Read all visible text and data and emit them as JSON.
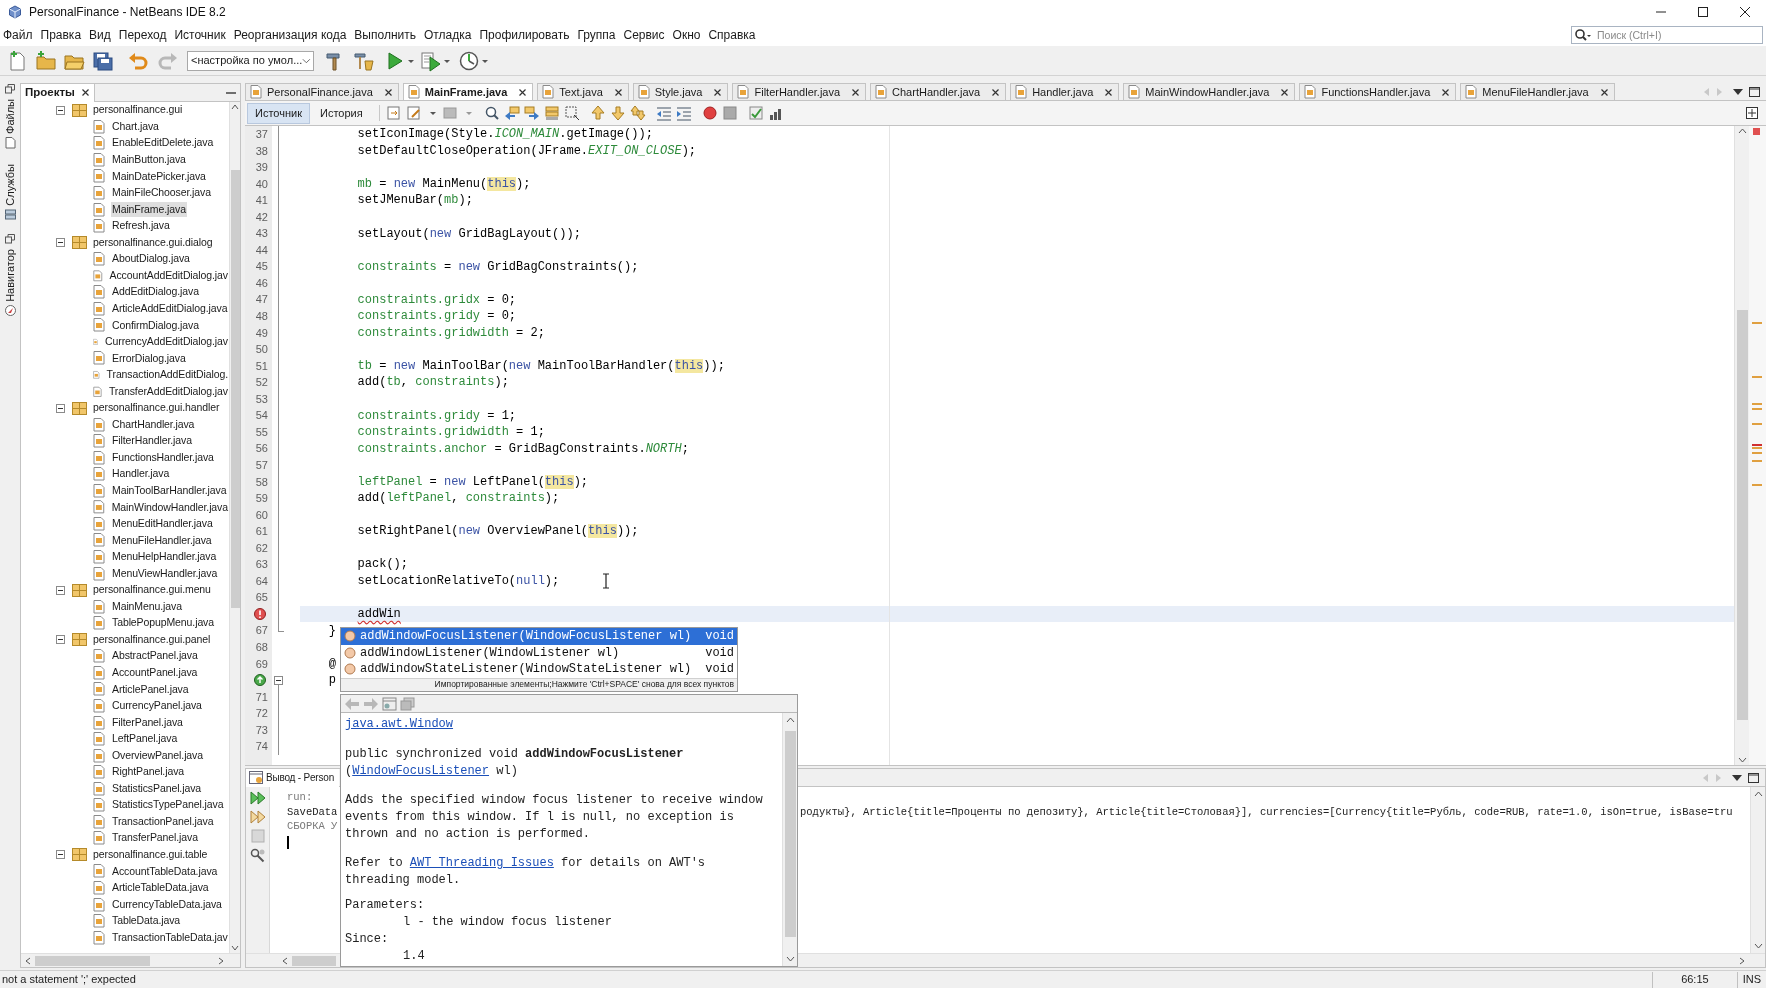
{
  "window": {
    "title": "PersonalFinance - NetBeans IDE 8.2"
  },
  "menu": [
    "Файл",
    "Правка",
    "Вид",
    "Переход",
    "Источник",
    "Реорганизация кода",
    "Выполнить",
    "Отладка",
    "Профилировать",
    "Группа",
    "Сервис",
    "Окно",
    "Справка"
  ],
  "search": {
    "placeholder": "Поиск (Ctrl+I)"
  },
  "toolbar": {
    "configuration": "<настройка по умол..."
  },
  "side_tabs": [
    "Файлы",
    "Службы",
    "Навигатор"
  ],
  "projects": {
    "title": "Проекты",
    "tree": [
      {
        "label": "personalfinance.gui",
        "kind": "package",
        "expanded": true,
        "selected": false,
        "children": [
          {
            "label": "Chart.java",
            "kind": "file",
            "selected": false
          },
          {
            "label": "EnableEditDelete.java",
            "kind": "file",
            "selected": false
          },
          {
            "label": "MainButton.java",
            "kind": "file",
            "selected": false
          },
          {
            "label": "MainDatePicker.java",
            "kind": "file",
            "selected": false
          },
          {
            "label": "MainFileChooser.java",
            "kind": "file",
            "selected": false
          },
          {
            "label": "MainFrame.java",
            "kind": "file",
            "selected": true
          },
          {
            "label": "Refresh.java",
            "kind": "file",
            "selected": false
          }
        ]
      },
      {
        "label": "personalfinance.gui.dialog",
        "kind": "package",
        "expanded": true,
        "selected": false,
        "children": [
          {
            "label": "AboutDialog.java",
            "kind": "file",
            "selected": false
          },
          {
            "label": "AccountAddEditDialog.jav",
            "kind": "file",
            "selected": false
          },
          {
            "label": "AddEditDialog.java",
            "kind": "file",
            "selected": false
          },
          {
            "label": "ArticleAddEditDialog.java",
            "kind": "file",
            "selected": false
          },
          {
            "label": "ConfirmDialog.java",
            "kind": "file",
            "selected": false
          },
          {
            "label": "CurrencyAddEditDialog.jav",
            "kind": "file",
            "selected": false
          },
          {
            "label": "ErrorDialog.java",
            "kind": "file",
            "selected": false
          },
          {
            "label": "TransactionAddEditDialog.",
            "kind": "file",
            "selected": false
          },
          {
            "label": "TransferAddEditDialog.jav",
            "kind": "file",
            "selected": false
          }
        ]
      },
      {
        "label": "personalfinance.gui.handler",
        "kind": "package",
        "expanded": true,
        "selected": false,
        "children": [
          {
            "label": "ChartHandler.java",
            "kind": "file",
            "selected": false
          },
          {
            "label": "FilterHandler.java",
            "kind": "file",
            "selected": false
          },
          {
            "label": "FunctionsHandler.java",
            "kind": "file",
            "selected": false
          },
          {
            "label": "Handler.java",
            "kind": "file",
            "selected": false
          },
          {
            "label": "MainToolBarHandler.java",
            "kind": "file",
            "selected": false
          },
          {
            "label": "MainWindowHandler.java",
            "kind": "file",
            "selected": false
          },
          {
            "label": "MenuEditHandler.java",
            "kind": "file",
            "selected": false
          },
          {
            "label": "MenuFileHandler.java",
            "kind": "file",
            "selected": false
          },
          {
            "label": "MenuHelpHandler.java",
            "kind": "file",
            "selected": false
          },
          {
            "label": "MenuViewHandler.java",
            "kind": "file",
            "selected": false
          }
        ]
      },
      {
        "label": "personalfinance.gui.menu",
        "kind": "package",
        "expanded": true,
        "selected": false,
        "children": [
          {
            "label": "MainMenu.java",
            "kind": "file",
            "selected": false
          },
          {
            "label": "TablePopupMenu.java",
            "kind": "file",
            "selected": false
          }
        ]
      },
      {
        "label": "personalfinance.gui.panel",
        "kind": "package",
        "expanded": true,
        "selected": false,
        "children": [
          {
            "label": "AbstractPanel.java",
            "kind": "file",
            "selected": false
          },
          {
            "label": "AccountPanel.java",
            "kind": "file",
            "selected": false
          },
          {
            "label": "ArticlePanel.java",
            "kind": "file",
            "selected": false
          },
          {
            "label": "CurrencyPanel.java",
            "kind": "file",
            "selected": false
          },
          {
            "label": "FilterPanel.java",
            "kind": "file",
            "selected": false
          },
          {
            "label": "LeftPanel.java",
            "kind": "file",
            "selected": false
          },
          {
            "label": "OverviewPanel.java",
            "kind": "file",
            "selected": false
          },
          {
            "label": "RightPanel.java",
            "kind": "file",
            "selected": false
          },
          {
            "label": "StatisticsPanel.java",
            "kind": "file",
            "selected": false
          },
          {
            "label": "StatisticsTypePanel.java",
            "kind": "file",
            "selected": false
          },
          {
            "label": "TransactionPanel.java",
            "kind": "file",
            "selected": false
          },
          {
            "label": "TransferPanel.java",
            "kind": "file",
            "selected": false
          }
        ]
      },
      {
        "label": "personalfinance.gui.table",
        "kind": "package",
        "expanded": true,
        "selected": false,
        "children": [
          {
            "label": "AccountTableData.java",
            "kind": "file",
            "selected": false
          },
          {
            "label": "ArticleTableData.java",
            "kind": "file",
            "selected": false
          },
          {
            "label": "CurrencyTableData.java",
            "kind": "file",
            "selected": false
          },
          {
            "label": "TableData.java",
            "kind": "file",
            "selected": false
          },
          {
            "label": "TransactionTableData.jav",
            "kind": "file",
            "selected": false
          }
        ]
      }
    ]
  },
  "editor": {
    "tabs": [
      {
        "label": "PersonalFinance.java",
        "selected": false
      },
      {
        "label": "MainFrame.java",
        "selected": true
      },
      {
        "label": "Text.java",
        "selected": false
      },
      {
        "label": "Style.java",
        "selected": false
      },
      {
        "label": "FilterHandler.java",
        "selected": false
      },
      {
        "label": "ChartHandler.java",
        "selected": false
      },
      {
        "label": "Handler.java",
        "selected": false
      },
      {
        "label": "MainWindowHandler.java",
        "selected": false
      },
      {
        "label": "FunctionsHandler.java",
        "selected": false
      },
      {
        "label": "MenuFileHandler.java",
        "selected": false
      }
    ],
    "views": [
      {
        "label": "Источник",
        "selected": true
      },
      {
        "label": "История",
        "selected": false
      }
    ],
    "lines": [
      {
        "number": "37",
        "kind": "guide",
        "current": false,
        "tokens": [
          {
            "kind": "text",
            "text": "        setIconImage(Style."
          },
          {
            "kind": "constant",
            "text": "ICON_MAIN"
          },
          {
            "kind": "text",
            "text": ".getImage());"
          }
        ]
      },
      {
        "number": "38",
        "kind": "guide",
        "current": false,
        "tokens": [
          {
            "kind": "text",
            "text": "        setDefaultCloseOperation(JFrame."
          },
          {
            "kind": "constant",
            "text": "EXIT_ON_CLOSE"
          },
          {
            "kind": "text",
            "text": ");"
          }
        ]
      },
      {
        "number": "39",
        "kind": "guide",
        "current": false
      },
      {
        "number": "40",
        "kind": "guide",
        "current": false,
        "tokens": [
          {
            "kind": "field",
            "text": "        mb"
          },
          {
            "kind": "text",
            "text": " = "
          },
          {
            "kind": "keyword",
            "text": "new"
          },
          {
            "kind": "text",
            "text": " MainMenu("
          },
          {
            "kind": "this",
            "text": "this"
          },
          {
            "kind": "text",
            "text": ");"
          }
        ]
      },
      {
        "number": "41",
        "kind": "guide",
        "current": false,
        "tokens": [
          {
            "kind": "text",
            "text": "        setJMenuBar("
          },
          {
            "kind": "field",
            "text": "mb"
          },
          {
            "kind": "text",
            "text": ");"
          }
        ]
      },
      {
        "number": "42",
        "kind": "guide",
        "current": false
      },
      {
        "number": "43",
        "kind": "guide",
        "current": false,
        "tokens": [
          {
            "kind": "text",
            "text": "        setLayout("
          },
          {
            "kind": "keyword",
            "text": "new"
          },
          {
            "kind": "text",
            "text": " GridBagLayout());"
          }
        ]
      },
      {
        "number": "44",
        "kind": "guide",
        "current": false
      },
      {
        "number": "45",
        "kind": "guide",
        "current": false,
        "tokens": [
          {
            "kind": "field",
            "text": "        constraints"
          },
          {
            "kind": "text",
            "text": " = "
          },
          {
            "kind": "keyword",
            "text": "new"
          },
          {
            "kind": "text",
            "text": " GridBagConstraints();"
          }
        ]
      },
      {
        "number": "46",
        "kind": "guide",
        "current": false
      },
      {
        "number": "47",
        "kind": "guide",
        "current": false,
        "tokens": [
          {
            "kind": "field",
            "text": "        constraints.gridx"
          },
          {
            "kind": "text",
            "text": " = 0;"
          }
        ]
      },
      {
        "number": "48",
        "kind": "guide",
        "current": false,
        "tokens": [
          {
            "kind": "field",
            "text": "        constraints.gridy"
          },
          {
            "kind": "text",
            "text": " = 0;"
          }
        ]
      },
      {
        "number": "49",
        "kind": "guide",
        "current": false,
        "tokens": [
          {
            "kind": "field",
            "text": "        constraints.gridwidth"
          },
          {
            "kind": "text",
            "text": " = 2;"
          }
        ]
      },
      {
        "number": "50",
        "kind": "guide",
        "current": false
      },
      {
        "number": "51",
        "kind": "guide",
        "current": false,
        "tokens": [
          {
            "kind": "field",
            "text": "        tb"
          },
          {
            "kind": "text",
            "text": " = "
          },
          {
            "kind": "keyword",
            "text": "new"
          },
          {
            "kind": "text",
            "text": " MainToolBar("
          },
          {
            "kind": "keyword",
            "text": "new"
          },
          {
            "kind": "text",
            "text": " MainToolBarHandler("
          },
          {
            "kind": "this",
            "text": "this"
          },
          {
            "kind": "text",
            "text": "));"
          }
        ]
      },
      {
        "number": "52",
        "kind": "guide",
        "current": false,
        "tokens": [
          {
            "kind": "text",
            "text": "        add("
          },
          {
            "kind": "field",
            "text": "tb"
          },
          {
            "kind": "text",
            "text": ", "
          },
          {
            "kind": "field",
            "text": "constraints"
          },
          {
            "kind": "text",
            "text": ");"
          }
        ]
      },
      {
        "number": "53",
        "kind": "guide",
        "current": false
      },
      {
        "number": "54",
        "kind": "guide",
        "current": false,
        "tokens": [
          {
            "kind": "field",
            "text": "        constraints.gridy"
          },
          {
            "kind": "text",
            "text": " = 1;"
          }
        ]
      },
      {
        "number": "55",
        "kind": "guide",
        "current": false,
        "tokens": [
          {
            "kind": "field",
            "text": "        constraints.gridwidth"
          },
          {
            "kind": "text",
            "text": " = 1;"
          }
        ]
      },
      {
        "number": "56",
        "kind": "guide",
        "current": false,
        "tokens": [
          {
            "kind": "field",
            "text": "        constraints.anchor"
          },
          {
            "kind": "text",
            "text": " = GridBagConstraints."
          },
          {
            "kind": "constant",
            "text": "NORTH"
          },
          {
            "kind": "text",
            "text": ";"
          }
        ]
      },
      {
        "number": "57",
        "kind": "guide",
        "current": false
      },
      {
        "number": "58",
        "kind": "guide",
        "current": false,
        "tokens": [
          {
            "kind": "field",
            "text": "        leftPanel"
          },
          {
            "kind": "text",
            "text": " = "
          },
          {
            "kind": "keyword",
            "text": "new"
          },
          {
            "kind": "text",
            "text": " LeftPanel("
          },
          {
            "kind": "this",
            "text": "this"
          },
          {
            "kind": "text",
            "text": ");"
          }
        ]
      },
      {
        "number": "59",
        "kind": "guide",
        "current": false,
        "tokens": [
          {
            "kind": "text",
            "text": "        add("
          },
          {
            "kind": "field",
            "text": "leftPanel"
          },
          {
            "kind": "text",
            "text": ", "
          },
          {
            "kind": "field",
            "text": "constraints"
          },
          {
            "kind": "text",
            "text": ");"
          }
        ]
      },
      {
        "number": "60",
        "kind": "guide",
        "current": false
      },
      {
        "number": "61",
        "kind": "guide",
        "current": false,
        "tokens": [
          {
            "kind": "text",
            "text": "        setRightPanel("
          },
          {
            "kind": "keyword",
            "text": "new"
          },
          {
            "kind": "text",
            "text": " OverviewPanel("
          },
          {
            "kind": "this",
            "text": "this"
          },
          {
            "kind": "text",
            "text": "));"
          }
        ]
      },
      {
        "number": "62",
        "kind": "guide",
        "current": false
      },
      {
        "number": "63",
        "kind": "guide",
        "current": false,
        "tokens": [
          {
            "kind": "text",
            "text": "        pack();"
          }
        ]
      },
      {
        "number": "64",
        "kind": "guide",
        "current": false,
        "tokens": [
          {
            "kind": "text",
            "text": "        setLocationRelativeTo("
          },
          {
            "kind": "keyword",
            "text": "null"
          },
          {
            "kind": "text",
            "text": ");"
          }
        ]
      },
      {
        "number": "65",
        "kind": "guide",
        "current": false
      },
      {
        "marker": {
          "kind": "error"
        },
        "kind": "guide",
        "current": true,
        "tokens": [
          {
            "kind": "error",
            "text": "        addWin"
          }
        ]
      },
      {
        "number": "67",
        "kind": "end",
        "current": false,
        "tokens": [
          {
            "kind": "text",
            "text": "    }"
          }
        ]
      },
      {
        "number": "68",
        "kind": "none",
        "current": false
      },
      {
        "number": "69",
        "kind": "none",
        "current": false,
        "tokens": [
          {
            "kind": "text",
            "text": "    @"
          }
        ]
      },
      {
        "marker": {
          "kind": "override"
        },
        "kind": "start",
        "current": false,
        "tokens": [
          {
            "kind": "text",
            "text": "    p"
          }
        ]
      },
      {
        "number": "71",
        "kind": "guide",
        "current": false
      },
      {
        "number": "72",
        "kind": "guide",
        "current": false
      },
      {
        "number": "73",
        "kind": "guide",
        "current": false
      },
      {
        "number": "74",
        "kind": "guide",
        "current": false
      }
    ]
  },
  "completion": {
    "items": [
      {
        "label": "addWindowFocusListener(WindowFocusListener wl)",
        "type": "void",
        "selected": true
      },
      {
        "label": "addWindowListener(WindowListener wl)",
        "type": "void",
        "selected": false
      },
      {
        "label": "addWindowStateListener(WindowStateListener wl)",
        "type": "void",
        "selected": false
      }
    ],
    "hint": "Импортированные элементы;Нажмите 'Ctrl+SPACE' снова для всех пунктов"
  },
  "javadoc": {
    "class_link": "java.awt.Window",
    "signature": {
      "line1": "public synchronized void **addWindowFocusListener**",
      "open": "(",
      "link": "WindowFocusListener",
      "close": " wl)"
    },
    "description": "Adds the specified window focus listener to receive window events from this window. If l is null, no exception is thrown and no action is performed.",
    "refer": {
      "before": "Refer to ",
      "link": "AWT Threading Issues",
      "after": " for details on AWT's threading model."
    },
    "sections": [
      {
        "heading": "Parameters:",
        "value": "l - the window focus listener"
      },
      {
        "heading": "Since:",
        "value": "1.4"
      }
    ]
  },
  "output": {
    "title": "Вывод - Person",
    "lines": [
      {
        "kind": "info",
        "text": "run:"
      },
      {
        "kind": "text",
        "text": "SaveData",
        "tail": "родукты}, Article{title=Проценты по депозиту}, Article{title=Столовая}], currencies=[Currency{title=Рубль, code=RUB, rate=1.0, isOn=true, isBase=tru"
      },
      {
        "kind": "info",
        "text": "СБОРКА У"
      }
    ]
  },
  "status_bar": {
    "message": "not a statement ';' expected",
    "position": "66:15",
    "mode": "INS"
  }
}
